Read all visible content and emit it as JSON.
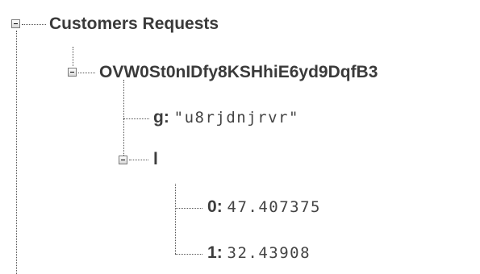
{
  "tree": {
    "root": {
      "label": "Customers Requests",
      "expanded": true,
      "child": {
        "label": "OVW0St0nIDfy8KSHhiE6yd9DqfB3",
        "expanded": true,
        "fields": {
          "g": {
            "key": "g",
            "sep": ":",
            "value": "\"u8rjdnjrvr\""
          },
          "l": {
            "key": "l",
            "expanded": true,
            "items": [
              {
                "key": "0",
                "sep": ":",
                "value": "47.407375"
              },
              {
                "key": "1",
                "sep": ":",
                "value": "32.43908"
              }
            ]
          }
        }
      }
    }
  },
  "colors": {
    "text": "#3a3a3a",
    "value_text": "#444444",
    "guide_line": "#555555",
    "background": "#ffffff"
  }
}
